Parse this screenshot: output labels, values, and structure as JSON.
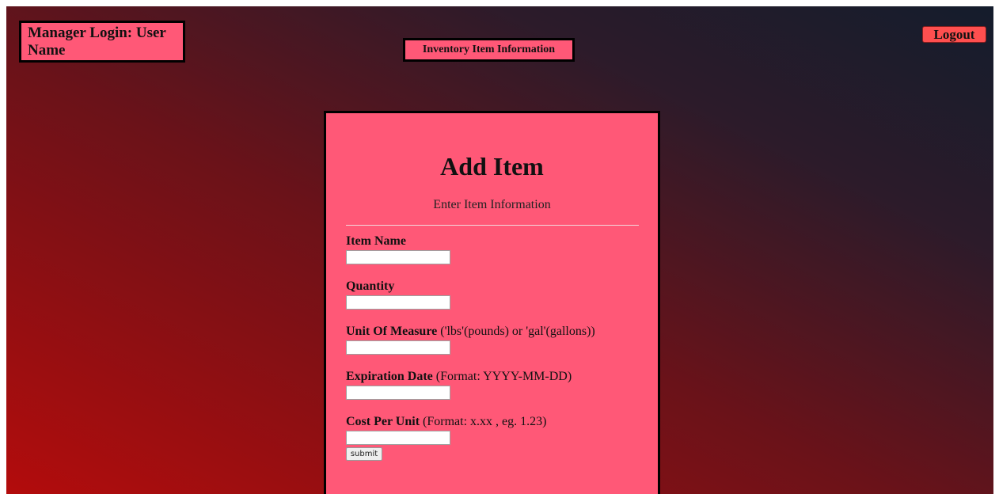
{
  "header": {
    "manager_label": "Manager Login: User Name",
    "section_label": "Inventory Item Information",
    "logout_label": "Logout"
  },
  "form": {
    "title": "Add Item",
    "subtitle": "Enter Item Information",
    "fields": [
      {
        "label": "Item Name",
        "hint": "",
        "value": ""
      },
      {
        "label": "Quantity",
        "hint": "",
        "value": ""
      },
      {
        "label": "Unit Of Measure",
        "hint": "('lbs'(pounds) or 'gal'(gallons))",
        "value": ""
      },
      {
        "label": "Expiration Date",
        "hint": "(Format: YYYY-MM-DD)",
        "value": ""
      },
      {
        "label": "Cost Per Unit",
        "hint": "(Format: x.xx , eg. 1.23)",
        "value": ""
      }
    ],
    "submit_label": "submit"
  },
  "colors": {
    "panel": "#ff5877",
    "logout": "#ff4f4f",
    "background_start": "#b30c0c",
    "background_end": "#141c2c"
  }
}
